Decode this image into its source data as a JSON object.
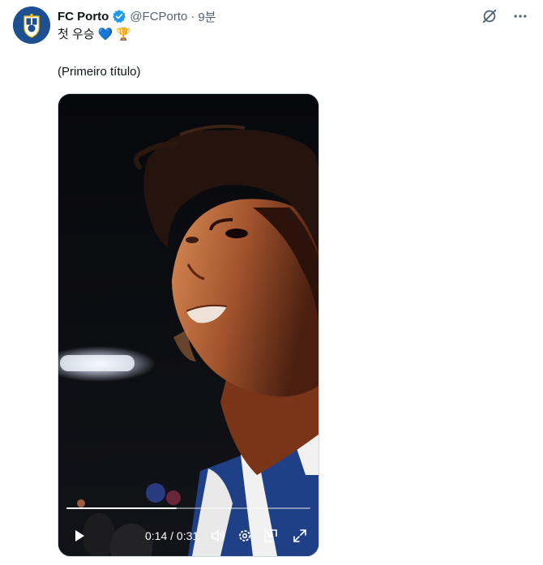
{
  "account": {
    "name": "FC Porto",
    "handle": "@FCPorto",
    "separator": "·",
    "time": "9분"
  },
  "tweet": {
    "text_line1": "첫 우승",
    "emoji_heart": "💙",
    "emoji_trophy": "🏆",
    "text_line2": "(Primeiro título)"
  },
  "video": {
    "timecode": "0:14 / 0:31",
    "progress": 0.4516
  },
  "icons": {
    "verified": "verified-badge-icon",
    "grok": "grok-icon",
    "more": "more-icon",
    "play": "play-icon",
    "volume": "volume-icon",
    "settings": "settings-icon",
    "pip": "picture-in-picture-icon",
    "fullscreen": "fullscreen-icon"
  },
  "colors": {
    "verified": "#1d9bf0",
    "secondary_text": "#536471",
    "avatar_bg": "#1d4f91"
  }
}
